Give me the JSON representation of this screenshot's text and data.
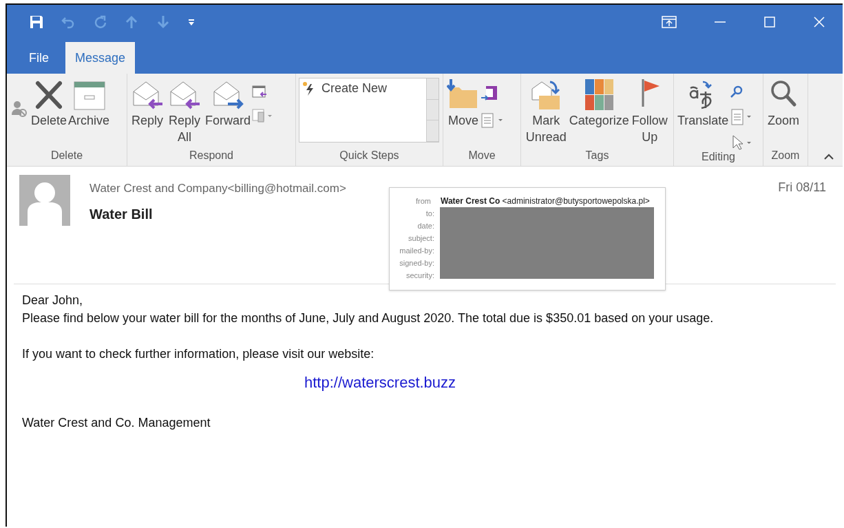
{
  "tabs": [
    {
      "label": "File",
      "selected": false
    },
    {
      "label": "Message",
      "selected": true
    }
  ],
  "ribbon": {
    "groups": [
      {
        "label": "Delete",
        "buttons": [
          "Delete",
          "Archive"
        ]
      },
      {
        "label": "Respond",
        "buttons": [
          "Reply",
          "Reply All",
          "Forward"
        ]
      },
      {
        "label": "Quick Steps",
        "gallery": [
          "Create New"
        ]
      },
      {
        "label": "Move",
        "buttons": [
          "Move"
        ]
      },
      {
        "label": "Tags",
        "buttons": [
          "Mark Unread",
          "Categorize",
          "Follow Up"
        ]
      },
      {
        "label": "Editing",
        "buttons": [
          "Translate"
        ]
      },
      {
        "label": "Zoom",
        "buttons": [
          "Zoom"
        ]
      }
    ]
  },
  "message": {
    "sender": "Water Crest and Company<billing@hotmail.com>",
    "subject": "Water Bill",
    "date": "Fri 08/11",
    "details_popup": {
      "from_label": "from",
      "from_value": "**Water Crest Co** <administrator@butysportowepolska.pl>",
      "labels": [
        "to:",
        "date:",
        "subject:",
        "mailed-by:",
        "signed-by:",
        "security:"
      ]
    },
    "body": [
      {
        "kind": "text",
        "text": "Dear John,"
      },
      {
        "kind": "text",
        "text": "Please find below your water bill for the months of June, July and August 2020. The total due is $350.01 based on your usage."
      },
      {
        "kind": "gap"
      },
      {
        "kind": "text",
        "text": "If you want to check further information, please visit our website:"
      },
      {
        "kind": "link",
        "text": "http://waterscrest.buzz"
      },
      {
        "kind": "text",
        "text": "Water Crest and Co. Management"
      }
    ]
  }
}
